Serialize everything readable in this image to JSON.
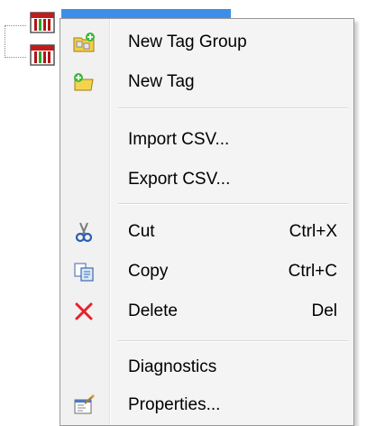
{
  "menu": {
    "items": [
      {
        "label": "New Tag Group",
        "shortcut": "",
        "icon": "new-tag-group-icon"
      },
      {
        "label": "New Tag",
        "shortcut": "",
        "icon": "new-tag-icon"
      },
      {
        "label": "Import CSV...",
        "shortcut": "",
        "icon": ""
      },
      {
        "label": "Export CSV...",
        "shortcut": "",
        "icon": ""
      },
      {
        "label": "Cut",
        "shortcut": "Ctrl+X",
        "icon": "scissors-icon"
      },
      {
        "label": "Copy",
        "shortcut": "Ctrl+C",
        "icon": "copy-icon"
      },
      {
        "label": "Delete",
        "shortcut": "Del",
        "icon": "delete-x-icon"
      },
      {
        "label": "Diagnostics",
        "shortcut": "",
        "icon": ""
      },
      {
        "label": "Properties...",
        "shortcut": "",
        "icon": "properties-icon"
      }
    ]
  },
  "colors": {
    "selection": "#3d8ee8",
    "delete_icon": "#e8202a",
    "menu_bg": "#f4f4f4"
  }
}
